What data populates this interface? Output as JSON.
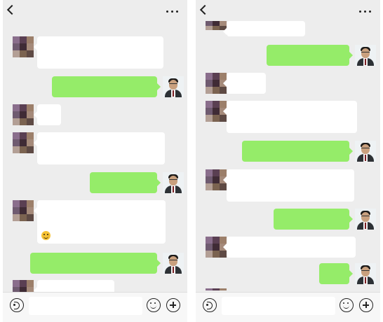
{
  "colors": {
    "chat_background": "#ededed",
    "incoming_bubble": "#ffffff",
    "outgoing_bubble": "#95ec69",
    "bottom_bar": "#f7f7f7"
  },
  "icons": {
    "back": "chevron-left",
    "menu": "ellipsis",
    "voice": "voice-wave",
    "emoji": "smiley",
    "more": "plus-circle"
  },
  "screens": [
    {
      "messages": [
        {
          "from": "contact"
        },
        {
          "from": "me"
        },
        {
          "from": "contact"
        },
        {
          "from": "contact"
        },
        {
          "from": "me"
        },
        {
          "from": "contact"
        },
        {
          "from": "me"
        },
        {
          "from": "contact"
        }
      ]
    },
    {
      "messages": [
        {
          "from": "contact"
        },
        {
          "from": "me"
        },
        {
          "from": "contact"
        },
        {
          "from": "contact"
        },
        {
          "from": "me"
        },
        {
          "from": "contact"
        },
        {
          "from": "me"
        },
        {
          "from": "contact"
        },
        {
          "from": "me"
        },
        {
          "from": "contact"
        }
      ]
    }
  ]
}
